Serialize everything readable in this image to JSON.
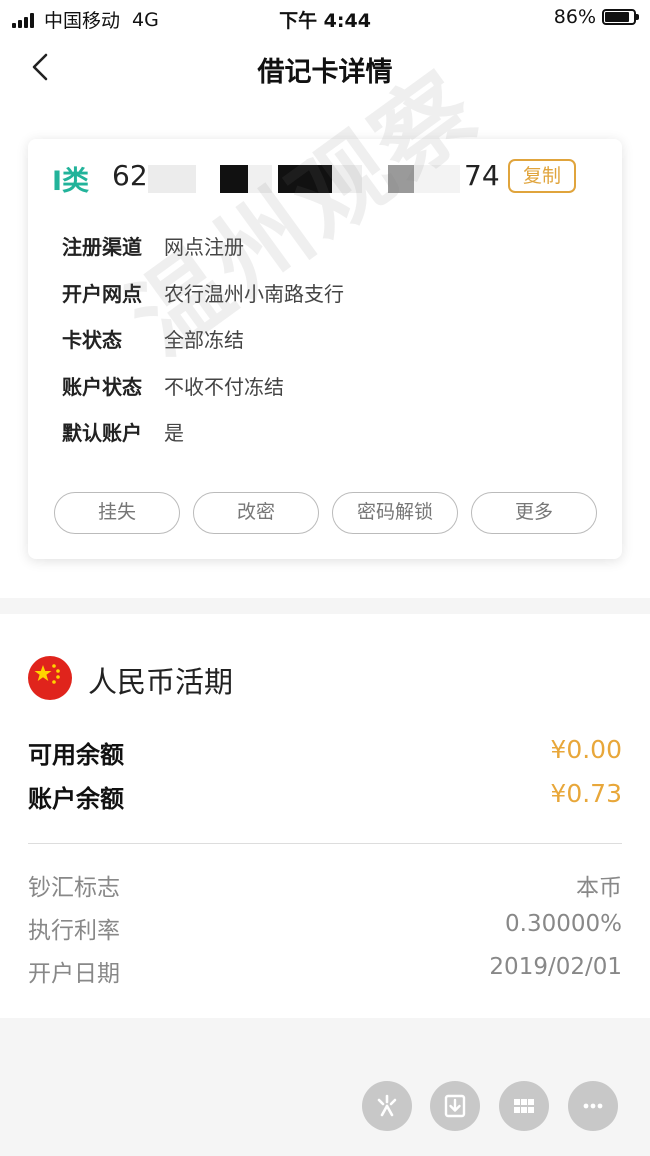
{
  "status_bar": {
    "carrier": "中国移动",
    "network": "4G",
    "time": "下午 4:44",
    "battery": "86%",
    "battery_level": 0.86
  },
  "nav": {
    "title": "借记卡详情",
    "back_icon": "chevron-left-icon"
  },
  "card": {
    "type": "I类",
    "number_prefix": "62",
    "number_suffix": "74",
    "copy_label": "复制",
    "info": [
      {
        "label": "注册渠道",
        "value": "网点注册"
      },
      {
        "label": "开户网点",
        "value": "农行温州小南路支行"
      },
      {
        "label": "卡状态",
        "value": "全部冻结"
      },
      {
        "label": "账户状态",
        "value": "不收不付冻结"
      },
      {
        "label": "默认账户",
        "value": "是"
      }
    ],
    "actions": [
      {
        "label": "挂失"
      },
      {
        "label": "改密"
      },
      {
        "label": "密码解锁"
      },
      {
        "label": "更多"
      }
    ]
  },
  "watermark": "温州观察",
  "account": {
    "flag_icon": "china-flag-icon",
    "currency_title": "人民币活期",
    "balances": [
      {
        "label": "可用余额",
        "value": "¥0.00"
      },
      {
        "label": "账户余额",
        "value": "¥0.73"
      }
    ],
    "details": [
      {
        "label": "钞汇标志",
        "value": "本币"
      },
      {
        "label": "执行利率",
        "value": "0.30000%"
      },
      {
        "label": "开户日期",
        "value": "2019/02/01"
      }
    ]
  },
  "floating_actions": [
    {
      "icon": "sparkle-icon"
    },
    {
      "icon": "download-icon"
    },
    {
      "icon": "grid-icon"
    },
    {
      "icon": "more-icon"
    }
  ],
  "colors": {
    "accent_gold": "#e8a73a",
    "card_type_teal": "#22b39a",
    "page_background": "#f5f5f5"
  }
}
